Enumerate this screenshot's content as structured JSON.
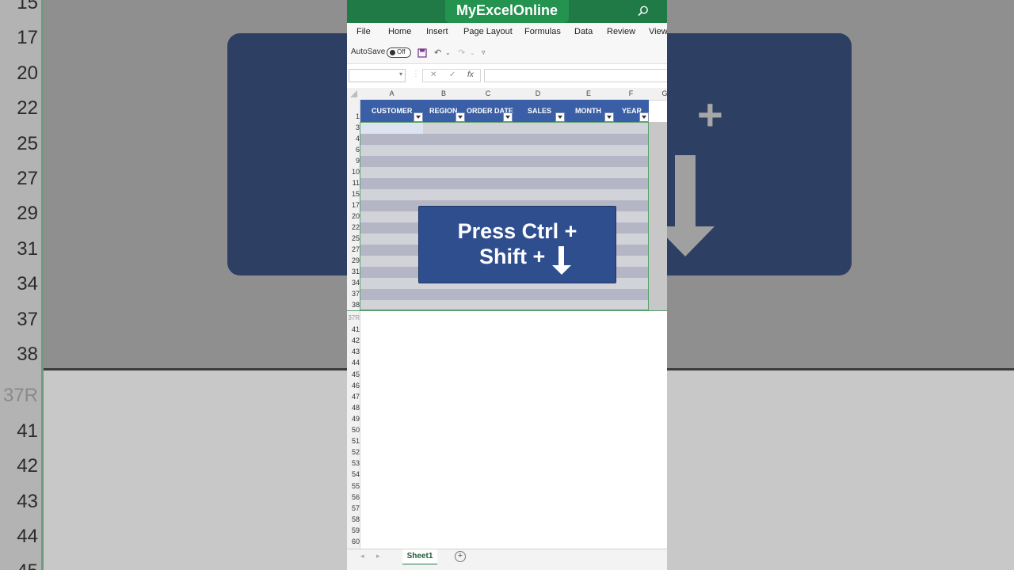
{
  "brand": "MyExcelOnline",
  "menu": [
    "File",
    "Home",
    "Insert",
    "Page Layout",
    "Formulas",
    "Data",
    "Review",
    "View"
  ],
  "qat": {
    "autosave_label": "AutoSave",
    "toggle_state": "Off"
  },
  "formula_bar": {
    "cancel": "✕",
    "enter": "✓",
    "fx": "fx"
  },
  "columns": [
    "A",
    "B",
    "C",
    "D",
    "E",
    "F",
    "G"
  ],
  "table_headers": [
    "CUSTOMER",
    "REGION",
    "ORDER DATE",
    "SALES",
    "MONTH",
    "YEAR"
  ],
  "grid_rows": [
    "3",
    "4",
    "6",
    "9",
    "10",
    "11",
    "15",
    "17",
    "20",
    "22",
    "25",
    "27",
    "29",
    "31",
    "34",
    "37",
    "38"
  ],
  "below_rows": [
    "37R",
    "41",
    "42",
    "43",
    "44",
    "45",
    "46",
    "47",
    "48",
    "49",
    "50",
    "51",
    "52",
    "53",
    "54",
    "55",
    "56",
    "57",
    "58",
    "59",
    "60"
  ],
  "header_row_number": "1",
  "overlay": {
    "line1": "Press Ctrl +",
    "line2": "Shift +"
  },
  "sheet": {
    "tab_label": "Sheet1",
    "add_label": "+"
  },
  "bg_rows": [
    "15",
    "17",
    "20",
    "22",
    "25",
    "27",
    "29",
    "31",
    "34",
    "37",
    "38",
    "37R",
    "41",
    "42",
    "43",
    "44",
    "45"
  ],
  "colors": {
    "excel_green": "#1f7a45",
    "table_blue": "#3b5fa6",
    "overlay_blue": "#2f4e8e"
  }
}
